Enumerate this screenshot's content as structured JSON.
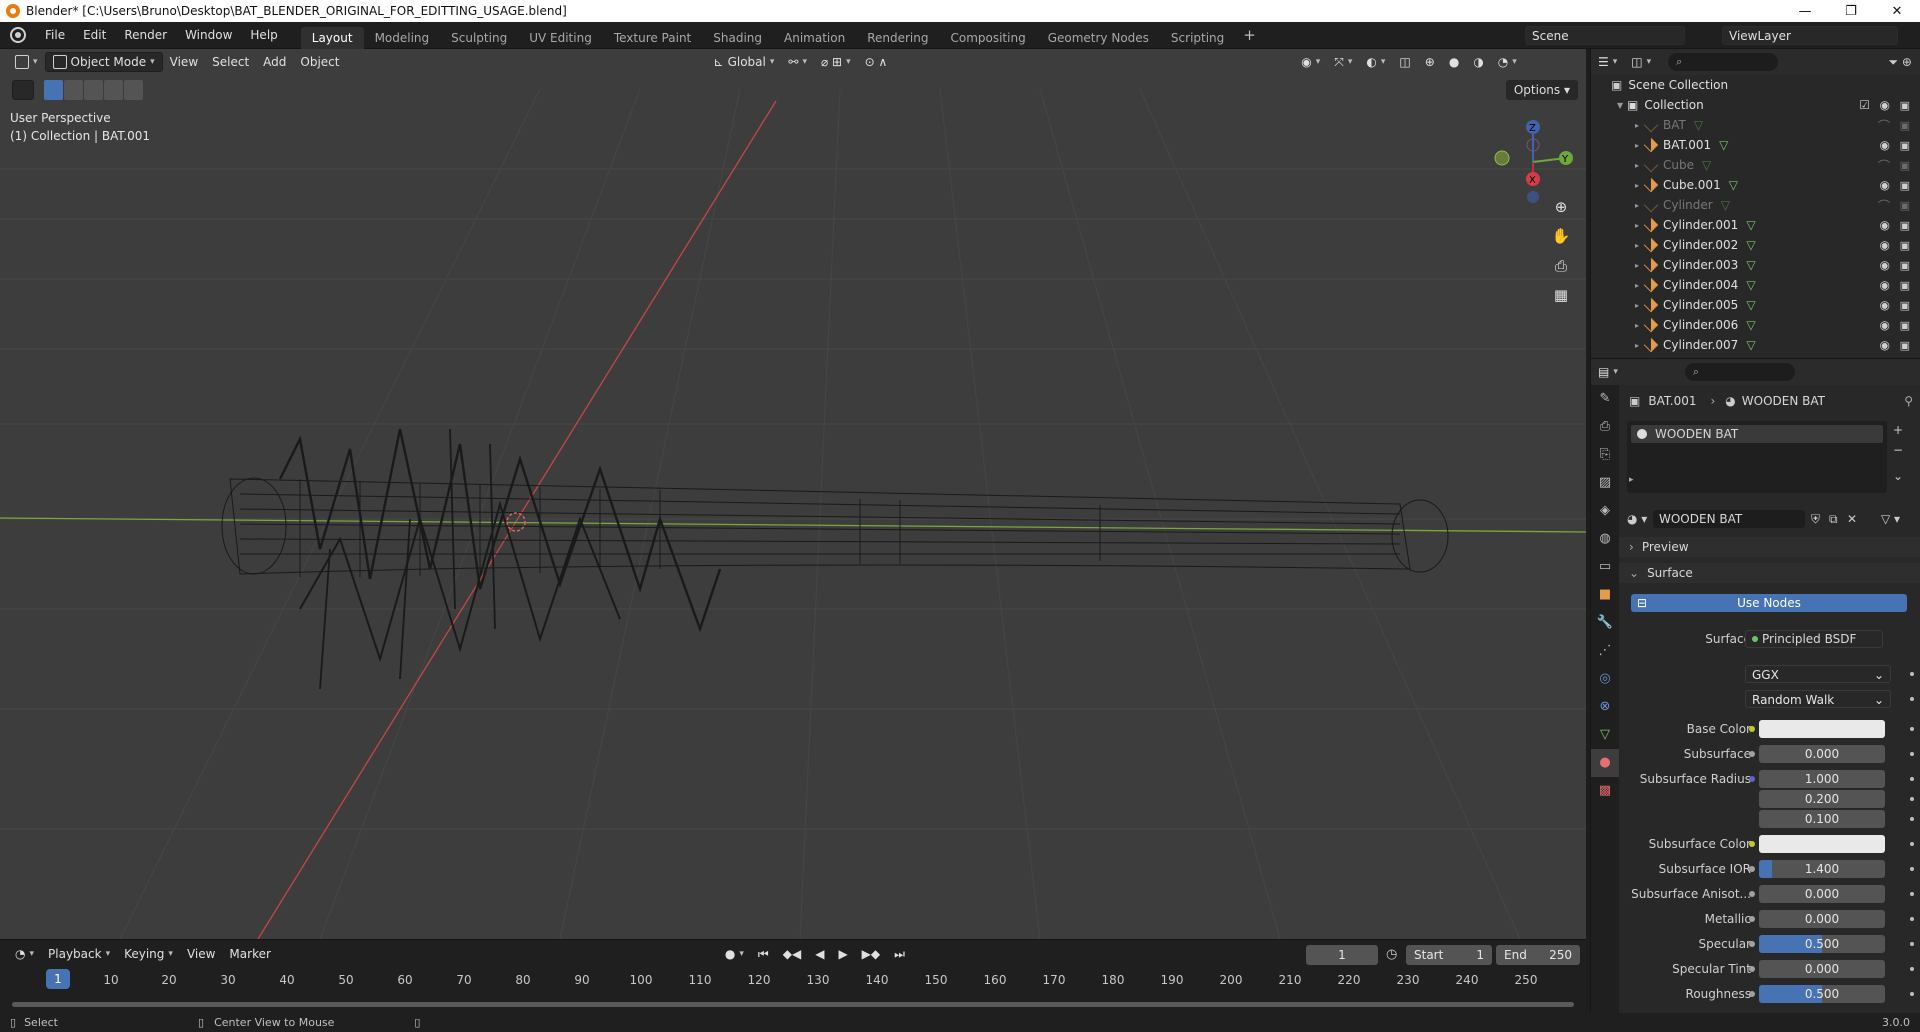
{
  "window": {
    "title": "Blender* [C:\\Users\\Bruno\\Desktop\\BAT_BLENDER_ORIGINAL_FOR_EDITTING_USAGE.blend]",
    "minimize": "—",
    "maximize": "❐",
    "close": "✕"
  },
  "menubar": {
    "menus": [
      "File",
      "Edit",
      "Render",
      "Window",
      "Help"
    ],
    "workspaces": [
      "Layout",
      "Modeling",
      "Sculpting",
      "UV Editing",
      "Texture Paint",
      "Shading",
      "Animation",
      "Rendering",
      "Compositing",
      "Geometry Nodes",
      "Scripting"
    ],
    "active_workspace": "Layout",
    "add_workspace": "+",
    "scene": "Scene",
    "view_layer": "ViewLayer"
  },
  "viewport": {
    "mode": "Object Mode",
    "menus": [
      "View",
      "Select",
      "Add",
      "Object"
    ],
    "orientation": "Global",
    "options": "Options",
    "info_line1": "User Perspective",
    "info_line2": "(1) Collection | BAT.001",
    "gizmo": {
      "z": "Z",
      "y": "Y",
      "x": "X"
    }
  },
  "timeline": {
    "menus": [
      "Playback",
      "Keying",
      "View",
      "Marker"
    ],
    "current_frame": "1",
    "start_label": "Start",
    "start_value": "1",
    "end_label": "End",
    "end_value": "250",
    "ruler": [
      "10",
      "20",
      "30",
      "40",
      "50",
      "60",
      "70",
      "80",
      "90",
      "100",
      "110",
      "120",
      "130",
      "140",
      "150",
      "160",
      "170",
      "180",
      "190",
      "200",
      "210",
      "220",
      "230",
      "240",
      "250"
    ]
  },
  "statusbar": {
    "select": "Select",
    "center": "Center View to Mouse",
    "version": "3.0.0"
  },
  "outliner": {
    "root": "Scene Collection",
    "collection": "Collection",
    "items": [
      {
        "name": "BAT",
        "dim": true
      },
      {
        "name": "BAT.001",
        "dim": false
      },
      {
        "name": "Cube",
        "dim": true
      },
      {
        "name": "Cube.001",
        "dim": false
      },
      {
        "name": "Cylinder",
        "dim": true
      },
      {
        "name": "Cylinder.001",
        "dim": false
      },
      {
        "name": "Cylinder.002",
        "dim": false
      },
      {
        "name": "Cylinder.003",
        "dim": false
      },
      {
        "name": "Cylinder.004",
        "dim": false
      },
      {
        "name": "Cylinder.005",
        "dim": false
      },
      {
        "name": "Cylinder.006",
        "dim": false
      },
      {
        "name": "Cylinder.007",
        "dim": false
      }
    ]
  },
  "properties": {
    "breadcrumb_object": "BAT.001",
    "breadcrumb_material": "WOODEN BAT",
    "slot_name": "WOODEN BAT",
    "material_name": "WOODEN BAT",
    "preview": "Preview",
    "surface_panel": "Surface",
    "use_nodes": "Use Nodes",
    "surface_label": "Surface",
    "surface_value": "Principled BSDF",
    "distribution": "GGX",
    "subsurface_method": "Random Walk",
    "fields": [
      {
        "label": "Base Color",
        "value": "",
        "dot": "yellow",
        "kind": "color"
      },
      {
        "label": "Subsurface",
        "value": "0.000",
        "dot": "gray",
        "kind": "num",
        "fill": 0
      },
      {
        "label": "Subsurface Radius",
        "value": "1.000",
        "dot": "blue",
        "kind": "num",
        "fill": 0
      },
      {
        "label": "",
        "value": "0.200",
        "dot": "",
        "kind": "num",
        "fill": 0
      },
      {
        "label": "",
        "value": "0.100",
        "dot": "",
        "kind": "num",
        "fill": 0
      },
      {
        "label": "Subsurface Color",
        "value": "",
        "dot": "yellow",
        "kind": "color"
      },
      {
        "label": "Subsurface IOR",
        "value": "1.400",
        "dot": "gray",
        "kind": "num",
        "fill": 0.1
      },
      {
        "label": "Subsurface Anisot...",
        "value": "0.000",
        "dot": "gray",
        "kind": "num",
        "fill": 0
      },
      {
        "label": "Metallic",
        "value": "0.000",
        "dot": "gray",
        "kind": "num",
        "fill": 0
      },
      {
        "label": "Specular",
        "value": "0.500",
        "dot": "gray",
        "kind": "num",
        "fill": 0.5
      },
      {
        "label": "Specular Tint",
        "value": "0.000",
        "dot": "gray",
        "kind": "num",
        "fill": 0
      },
      {
        "label": "Roughness",
        "value": "0.500",
        "dot": "gray",
        "kind": "num",
        "fill": 0.5
      }
    ]
  },
  "colors": {
    "accent": "#4772b3",
    "viewport_bg": "#3d3d3d",
    "x_axis": "#c24747",
    "y_axis": "#7aa83d",
    "object_icon": "#e59d4b",
    "mesh_icon": "#7ec26c"
  }
}
